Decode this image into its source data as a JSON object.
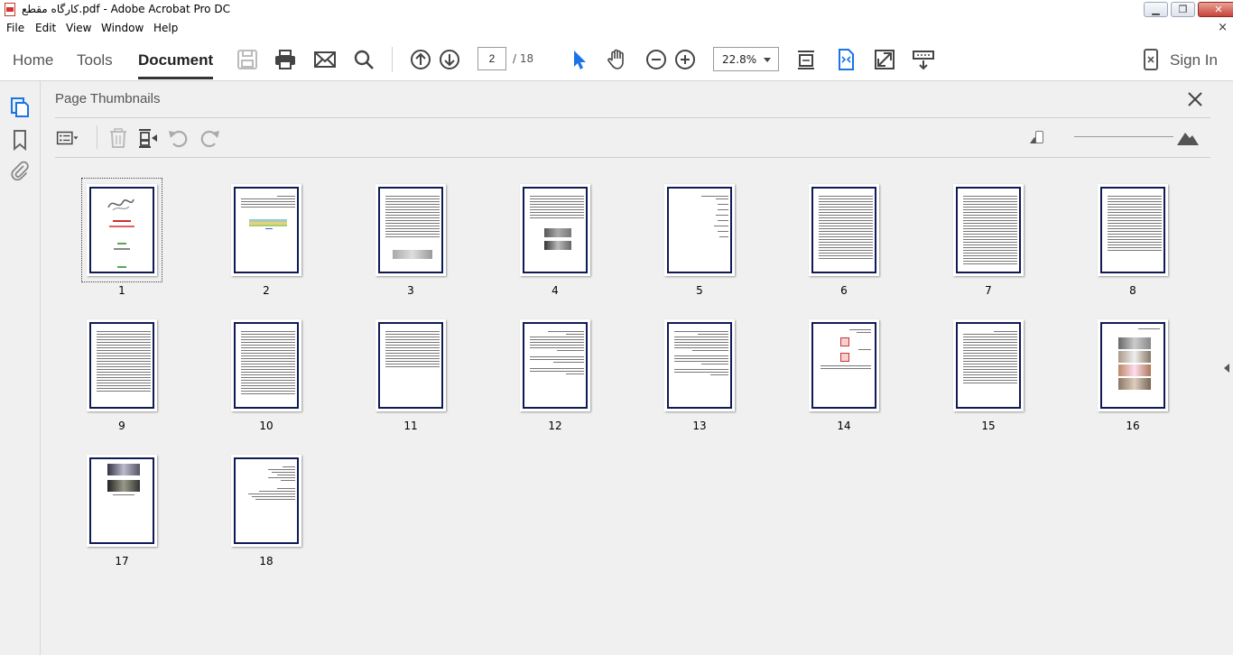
{
  "window": {
    "title": "کارگاه مقطع.pdf - Adobe Acrobat Pro DC",
    "minimize_label": "▁",
    "restore_label": "❐",
    "close_label": "✕"
  },
  "menu": {
    "items": [
      "File",
      "Edit",
      "View",
      "Window",
      "Help"
    ],
    "close_label": "×"
  },
  "toolbar": {
    "tabs": [
      {
        "label": "Home",
        "active": false
      },
      {
        "label": "Tools",
        "active": false
      },
      {
        "label": "Document",
        "active": true
      }
    ],
    "page_current": "2",
    "page_total": "/ 18",
    "zoom": "22.8%",
    "sign_in_label": "Sign In"
  },
  "panel": {
    "title": "Page Thumbnails"
  },
  "thumbnails": {
    "selected": 1,
    "pages": [
      "1",
      "2",
      "3",
      "4",
      "5",
      "6",
      "7",
      "8",
      "9",
      "10",
      "11",
      "12",
      "13",
      "14",
      "15",
      "16",
      "17",
      "18"
    ]
  }
}
